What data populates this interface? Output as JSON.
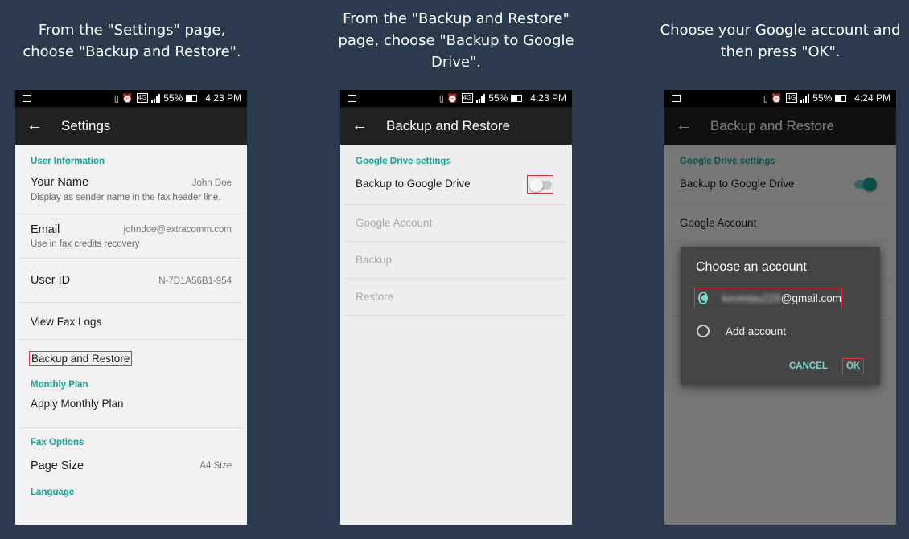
{
  "captions": {
    "step1": "From the \"Settings\" page, choose \"Backup and Restore\".",
    "step2": "From the \"Backup and Restore\" page, choose \"Backup to Google Drive\".",
    "step3": "Choose your Google account and then press \"OK\"."
  },
  "status": {
    "battery": "55%",
    "time1": "4:23 PM",
    "time2": "4:23 PM",
    "time3": "4:24 PM",
    "network": "4G"
  },
  "settings": {
    "title": "Settings",
    "section_user": "User Information",
    "your_name": "Your Name",
    "your_name_value": "John Doe",
    "your_name_desc": "Display as sender name in the fax header line.",
    "email": "Email",
    "email_value": "johndoe@extracomm.com",
    "email_desc": "Use in fax credits recovery",
    "user_id": "User ID",
    "user_id_value": "N-7D1A56B1-954",
    "view_fax_logs": "View Fax Logs",
    "backup_restore": "Backup and Restore",
    "section_monthly": "Monthly Plan",
    "apply_monthly": "Apply Monthly Plan",
    "section_fax": "Fax Options",
    "page_size": "Page Size",
    "page_size_value": "A4 Size",
    "section_language": "Language"
  },
  "backup": {
    "title": "Backup and Restore",
    "section_drive": "Google Drive settings",
    "backup_to_drive": "Backup to Google Drive",
    "google_account": "Google Account",
    "backup": "Backup",
    "restore": "Restore",
    "toggle_off": false,
    "toggle_on": true
  },
  "dialog": {
    "title": "Choose an account",
    "account_blurred": "kevintau228",
    "account_domain": "@gmail.com",
    "add_account": "Add account",
    "cancel": "CANCEL",
    "ok": "OK"
  },
  "colors": {
    "background": "#2b3b4d",
    "accent": "#14a094",
    "highlight": "#e0303a",
    "appbar": "#212121"
  }
}
